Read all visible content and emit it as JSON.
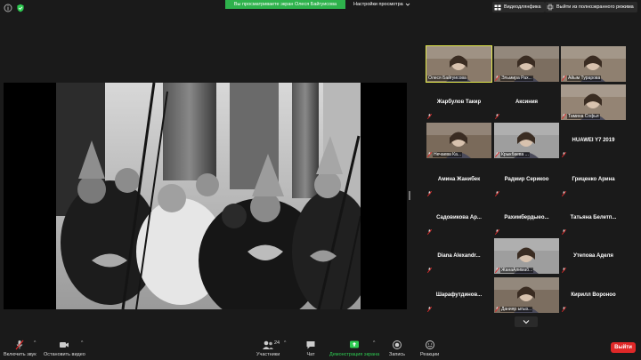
{
  "topbar": {
    "share_banner": "Вы просматриваете экран Олеся Байгуисова",
    "view_options": "Настройки просмотра",
    "share_banner_color": "#2eb24c",
    "buttons": [
      {
        "label": "Видеодлянфика",
        "icon": "grid-view-icon"
      },
      {
        "label": "Выйти из полноэкранного режима",
        "icon": "exit-fullscreen-icon"
      }
    ]
  },
  "gallery": {
    "tiles": [
      {
        "name": "Олеся Байгуисова",
        "video": true,
        "active": true,
        "muted": false
      },
      {
        "name": "Эльмира Рах...",
        "video": true,
        "active": false,
        "muted": true
      },
      {
        "name": "Айым Турарова",
        "video": true,
        "active": false,
        "muted": true
      },
      {
        "name": "Жарбулов Такир",
        "video": false,
        "muted": true
      },
      {
        "name": "Аксиния",
        "video": false,
        "muted": true
      },
      {
        "name": "Тамина Софья",
        "video": true,
        "muted": true
      },
      {
        "name": "Нечаева Ка...",
        "video": true,
        "muted": true
      },
      {
        "name": "Крыкбаева ...",
        "video": true,
        "muted": true
      },
      {
        "name": "HUAWEI Y7 2019",
        "video": false,
        "muted": true
      },
      {
        "name": "Амина Жанибек",
        "video": false,
        "muted": true
      },
      {
        "name": "Радмир Серикоо",
        "video": false,
        "muted": true
      },
      {
        "name": "Гриценко Арина",
        "video": false,
        "muted": true
      },
      {
        "name": "Садовикова Ар...",
        "video": false,
        "muted": true
      },
      {
        "name": "Рахимбердыео...",
        "video": false,
        "muted": true
      },
      {
        "name": "Татьяна Белетп...",
        "video": false,
        "muted": true
      },
      {
        "name": "Diana Alexandr...",
        "video": false,
        "muted": true
      },
      {
        "name": "ЖанаАлимаб...",
        "video": true,
        "muted": true
      },
      {
        "name": "Утепова Аделя",
        "video": false,
        "muted": true
      },
      {
        "name": "Шарафутдинов...",
        "video": false,
        "muted": true
      },
      {
        "name": "Данияр ыгыз...",
        "video": true,
        "muted": true
      },
      {
        "name": "Кирилл Вороноо",
        "video": false,
        "muted": true
      }
    ]
  },
  "toolbar": {
    "unmute_label": "Включить звук",
    "stop_video_label": "Остановить видео",
    "participants_label": "Участники",
    "participants_count": "24",
    "chat_label": "Чат",
    "share_label": "Демонстрация экрана",
    "record_label": "Запись",
    "reactions_label": "Реакции",
    "end_label": "Выйти",
    "share_color": "#2ecc52",
    "end_color": "#e02828"
  }
}
